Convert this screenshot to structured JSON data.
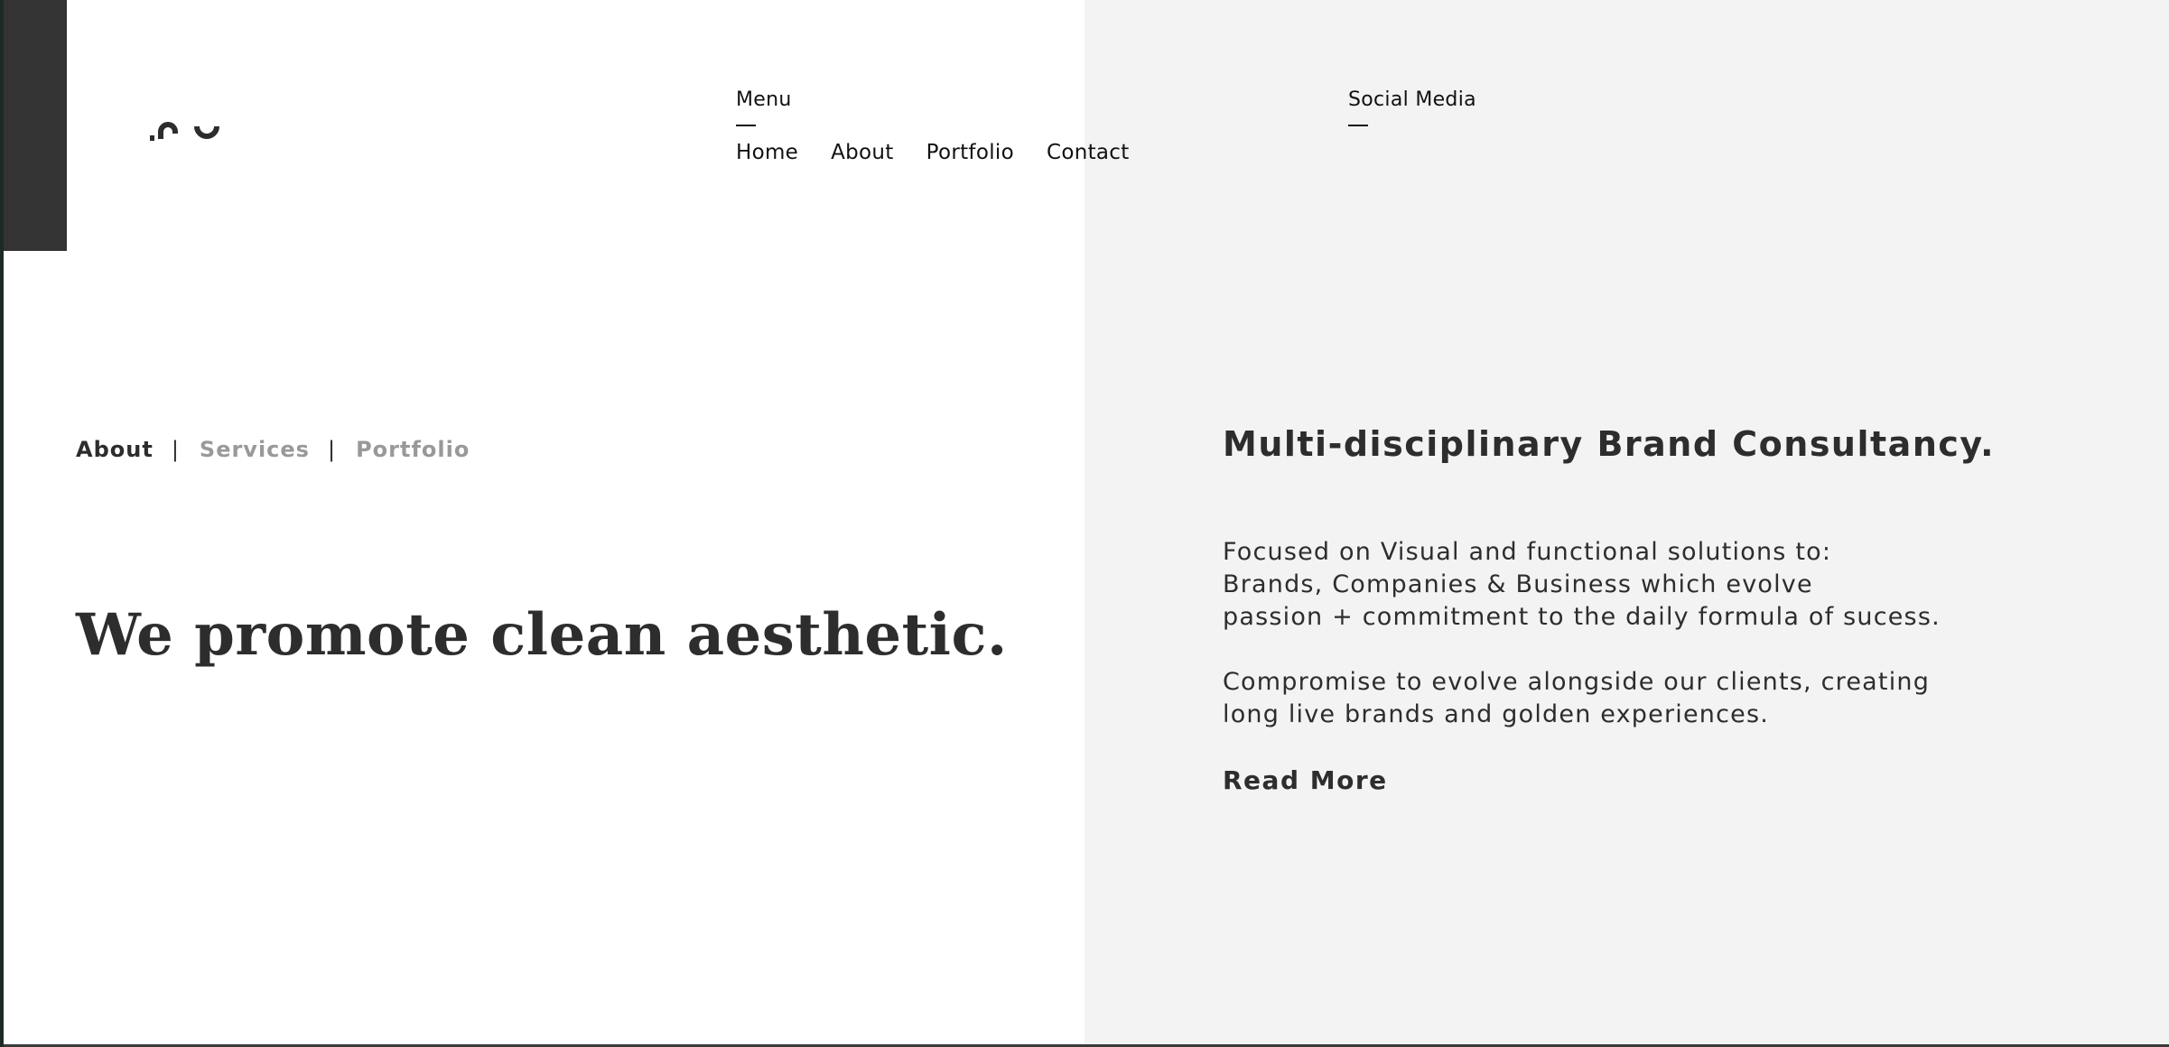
{
  "colors": {
    "left_bg": "#ffffff",
    "right_bg": "#f3f3f3",
    "dark_strip": "#333333",
    "text": "#2d2d2d",
    "muted": "#999999"
  },
  "header": {
    "logo_icon": "squiggle-logo",
    "menu": {
      "label": "Menu",
      "links": [
        "Home",
        "About",
        "Portfolio",
        "Contact"
      ]
    },
    "social": {
      "label": "Social Media"
    }
  },
  "subnav": {
    "items": [
      "About",
      "Services",
      "Portfolio"
    ],
    "separator": "|"
  },
  "hero": {
    "headline": "We promote clean aesthetic."
  },
  "about_panel": {
    "title": "Multi-disciplinary Brand Consultancy.",
    "paragraph1": [
      "Focused on Visual and functional solutions to:",
      "Brands, Companies & Business which evolve",
      "passion + commitment to the daily formula of sucess."
    ],
    "paragraph2": [
      "Compromise to evolve alongside our clients, creating",
      "long live brands and golden experiences."
    ],
    "cta": "Read More"
  }
}
